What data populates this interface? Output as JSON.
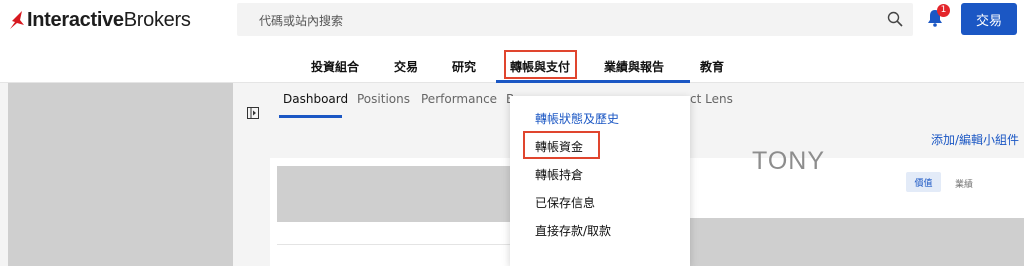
{
  "brand": {
    "name_bold": "Interactive",
    "name_regular": "Brokers",
    "accent": "#d71920"
  },
  "search": {
    "placeholder": "代碼或站內搜索",
    "icon": "search-icon"
  },
  "notifications": {
    "count": "1",
    "icon": "bell-icon"
  },
  "trade_button": "交易",
  "nav": {
    "items": [
      "投資組合",
      "交易",
      "研究",
      "轉帳與支付",
      "業績與報告",
      "教育"
    ],
    "active_index": 3
  },
  "tabs": {
    "items": [
      "Dashboard",
      "Positions",
      "Performance",
      "B",
      "ct Lens"
    ],
    "active_index": 0
  },
  "widget_link": "添加/編輯小組件",
  "watermark": "TONY",
  "toggle": {
    "value_label": "價值",
    "business_label": "業績"
  },
  "dropdown": {
    "items": [
      "轉帳狀態及歷史",
      "轉帳資金",
      "轉帳持倉",
      "已保存信息",
      "直接存款/取款"
    ],
    "highlighted_index": 1
  },
  "colors": {
    "primary": "#1b57c4",
    "highlight_border": "#e0452e",
    "badge": "#e4252b"
  }
}
